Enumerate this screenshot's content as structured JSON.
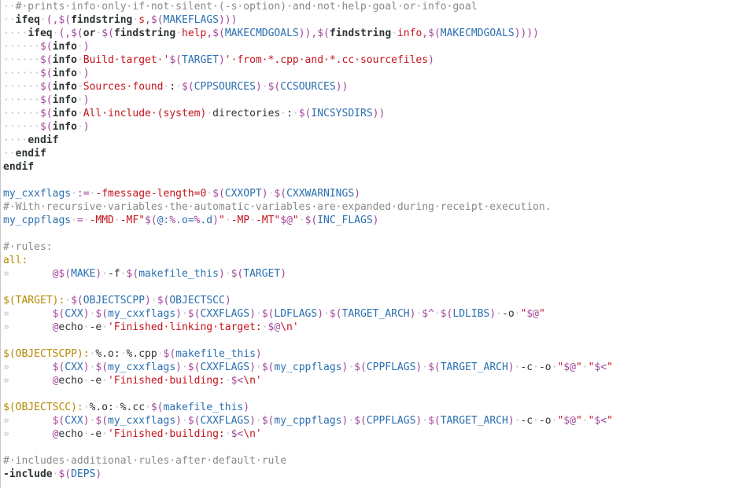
{
  "editor": {
    "language": "Makefile",
    "lines": [
      [
        [
          "ws",
          "··"
        ],
        [
          "cm",
          "#·prints·info·only·if·not·silent·(-s·option)·and·not·help·goal·or·info·goal"
        ]
      ],
      [
        [
          "ws",
          "··"
        ],
        [
          "kw",
          "ifeq"
        ],
        [
          "ws",
          "·"
        ],
        [
          "dl",
          "(,$("
        ],
        [
          "fn",
          "findstring"
        ],
        [
          "ws",
          "·"
        ],
        [
          "str",
          "s"
        ],
        [
          "dl",
          ",$("
        ],
        [
          "var",
          "MAKEFLAGS"
        ],
        [
          "dl",
          ")))"
        ]
      ],
      [
        [
          "ws",
          "····"
        ],
        [
          "kw",
          "ifeq"
        ],
        [
          "ws",
          "·"
        ],
        [
          "dl",
          "(,$("
        ],
        [
          "fn",
          "or"
        ],
        [
          "ws",
          "·"
        ],
        [
          "dl",
          "$("
        ],
        [
          "fn",
          "findstring"
        ],
        [
          "ws",
          "·"
        ],
        [
          "str",
          "help"
        ],
        [
          "dl",
          ",$("
        ],
        [
          "var",
          "MAKECMDGOALS"
        ],
        [
          "dl",
          "))"
        ],
        [
          "dl",
          ",$("
        ],
        [
          "fn",
          "findstring"
        ],
        [
          "ws",
          "·"
        ],
        [
          "str",
          "info"
        ],
        [
          "dl",
          ",$("
        ],
        [
          "var",
          "MAKECMDGOALS"
        ],
        [
          "dl",
          "))))"
        ]
      ],
      [
        [
          "ws",
          "······"
        ],
        [
          "dl",
          "$("
        ],
        [
          "fn",
          "info"
        ],
        [
          "ws",
          "·"
        ],
        [
          "dl",
          ")"
        ]
      ],
      [
        [
          "ws",
          "······"
        ],
        [
          "dl",
          "$("
        ],
        [
          "fn",
          "info"
        ],
        [
          "ws",
          "·"
        ],
        [
          "str",
          "Build·target·'"
        ],
        [
          "dl",
          "$("
        ],
        [
          "var",
          "TARGET"
        ],
        [
          "dl",
          ")"
        ],
        [
          "str",
          "'·from·*.cpp·and·*.cc·sourcefiles"
        ],
        [
          "dl",
          ")"
        ]
      ],
      [
        [
          "ws",
          "······"
        ],
        [
          "dl",
          "$("
        ],
        [
          "fn",
          "info"
        ],
        [
          "ws",
          "·"
        ],
        [
          "dl",
          ")"
        ]
      ],
      [
        [
          "ws",
          "······"
        ],
        [
          "dl",
          "$("
        ],
        [
          "fn",
          "info"
        ],
        [
          "ws",
          "·"
        ],
        [
          "str",
          "Sources·found"
        ],
        [
          "ws",
          "·"
        ],
        [
          "plain",
          ":"
        ],
        [
          "ws",
          "·"
        ],
        [
          "dl",
          "$("
        ],
        [
          "var",
          "CPPSOURCES"
        ],
        [
          "dl",
          ")"
        ],
        [
          "ws",
          "·"
        ],
        [
          "dl",
          "$("
        ],
        [
          "var",
          "CCSOURCES"
        ],
        [
          "dl",
          "))"
        ]
      ],
      [
        [
          "ws",
          "······"
        ],
        [
          "dl",
          "$("
        ],
        [
          "fn",
          "info"
        ],
        [
          "ws",
          "·"
        ],
        [
          "dl",
          ")"
        ]
      ],
      [
        [
          "ws",
          "······"
        ],
        [
          "dl",
          "$("
        ],
        [
          "fn",
          "info"
        ],
        [
          "ws",
          "·"
        ],
        [
          "str",
          "All·include·(system)"
        ],
        [
          "ws",
          "·"
        ],
        [
          "plain",
          "directories"
        ],
        [
          "ws",
          "·"
        ],
        [
          "plain",
          ":"
        ],
        [
          "ws",
          "·"
        ],
        [
          "dl",
          "$("
        ],
        [
          "var",
          "INCSYSDIRS"
        ],
        [
          "dl",
          "))"
        ]
      ],
      [
        [
          "ws",
          "······"
        ],
        [
          "dl",
          "$("
        ],
        [
          "fn",
          "info"
        ],
        [
          "ws",
          "·"
        ],
        [
          "dl",
          ")"
        ]
      ],
      [
        [
          "ws",
          "····"
        ],
        [
          "kw",
          "endif"
        ]
      ],
      [
        [
          "ws",
          "··"
        ],
        [
          "kw",
          "endif"
        ]
      ],
      [
        [
          "kw",
          "endif"
        ]
      ],
      [],
      [
        [
          "lhs",
          "my_cxxflags"
        ],
        [
          "ws",
          "·"
        ],
        [
          "op",
          ":="
        ],
        [
          "ws",
          "·"
        ],
        [
          "str",
          "-fmessage-length=0"
        ],
        [
          "ws",
          "·"
        ],
        [
          "dl",
          "$("
        ],
        [
          "var",
          "CXXOPT"
        ],
        [
          "dl",
          ")"
        ],
        [
          "ws",
          "·"
        ],
        [
          "dl",
          "$("
        ],
        [
          "var",
          "CXXWARNINGS"
        ],
        [
          "dl",
          ")"
        ]
      ],
      [
        [
          "cm",
          "#·With·recursive·variables·the·automatic·variables·are·expanded·during·receipt·execution."
        ]
      ],
      [
        [
          "lhs",
          "my_cppflags"
        ],
        [
          "ws",
          "·"
        ],
        [
          "op",
          "="
        ],
        [
          "ws",
          "·"
        ],
        [
          "str",
          "-MMD"
        ],
        [
          "ws",
          "·"
        ],
        [
          "str",
          "-MF\""
        ],
        [
          "dl",
          "$("
        ],
        [
          "var",
          "@:"
        ],
        [
          "dl",
          "%"
        ],
        [
          "var",
          ".o="
        ],
        [
          "dl",
          "%"
        ],
        [
          "var",
          ".d"
        ],
        [
          "dl",
          ")"
        ],
        [
          "str",
          "\""
        ],
        [
          "ws",
          "·"
        ],
        [
          "str",
          "-MP"
        ],
        [
          "ws",
          "·"
        ],
        [
          "str",
          "-MT\""
        ],
        [
          "dl",
          "$@"
        ],
        [
          "str",
          "\""
        ],
        [
          "ws",
          "·"
        ],
        [
          "dl",
          "$("
        ],
        [
          "var",
          "INC_FLAGS"
        ],
        [
          "dl",
          ")"
        ]
      ],
      [],
      [
        [
          "cm",
          "#·rules:"
        ]
      ],
      [
        [
          "tgt",
          "all:"
        ]
      ],
      [
        [
          "tab",
          "»"
        ],
        [
          "dl",
          "@$("
        ],
        [
          "var",
          "MAKE"
        ],
        [
          "dl",
          ")"
        ],
        [
          "ws",
          "·"
        ],
        [
          "plain",
          "-f"
        ],
        [
          "ws",
          "·"
        ],
        [
          "dl",
          "$("
        ],
        [
          "var",
          "makefile_this"
        ],
        [
          "dl",
          ")"
        ],
        [
          "ws",
          "·"
        ],
        [
          "dl",
          "$("
        ],
        [
          "var",
          "TARGET"
        ],
        [
          "dl",
          ")"
        ]
      ],
      [],
      [
        [
          "tgt",
          "$(TARGET):"
        ],
        [
          "ws",
          "·"
        ],
        [
          "dl",
          "$("
        ],
        [
          "var",
          "OBJECTSCPP"
        ],
        [
          "dl",
          ")"
        ],
        [
          "ws",
          "·"
        ],
        [
          "dl",
          "$("
        ],
        [
          "var",
          "OBJECTSCC"
        ],
        [
          "dl",
          ")"
        ]
      ],
      [
        [
          "tab",
          "»"
        ],
        [
          "dl",
          "$("
        ],
        [
          "var",
          "CXX"
        ],
        [
          "dl",
          ")"
        ],
        [
          "ws",
          "·"
        ],
        [
          "dl",
          "$("
        ],
        [
          "var",
          "my_cxxflags"
        ],
        [
          "dl",
          ")"
        ],
        [
          "ws",
          "·"
        ],
        [
          "dl",
          "$("
        ],
        [
          "var",
          "CXXFLAGS"
        ],
        [
          "dl",
          ")"
        ],
        [
          "ws",
          "·"
        ],
        [
          "dl",
          "$("
        ],
        [
          "var",
          "LDFLAGS"
        ],
        [
          "dl",
          ")"
        ],
        [
          "ws",
          "·"
        ],
        [
          "dl",
          "$("
        ],
        [
          "var",
          "TARGET_ARCH"
        ],
        [
          "dl",
          ")"
        ],
        [
          "ws",
          "·"
        ],
        [
          "dl",
          "$^"
        ],
        [
          "ws",
          "·"
        ],
        [
          "dl",
          "$("
        ],
        [
          "var",
          "LDLIBS"
        ],
        [
          "dl",
          ")"
        ],
        [
          "ws",
          "·"
        ],
        [
          "plain",
          "-o"
        ],
        [
          "ws",
          "·"
        ],
        [
          "str",
          "\""
        ],
        [
          "dl",
          "$@"
        ],
        [
          "str",
          "\""
        ]
      ],
      [
        [
          "tab",
          "»"
        ],
        [
          "dl",
          "@"
        ],
        [
          "plain",
          "echo"
        ],
        [
          "ws",
          "·"
        ],
        [
          "plain",
          "-e"
        ],
        [
          "ws",
          "·"
        ],
        [
          "str",
          "'Finished·linking·target:"
        ],
        [
          "ws",
          "·"
        ],
        [
          "dl",
          "$@"
        ],
        [
          "str",
          "\\n'"
        ]
      ],
      [],
      [
        [
          "tgt",
          "$(OBJECTSCPP):"
        ],
        [
          "ws",
          "·"
        ],
        [
          "plain",
          "%.o:"
        ],
        [
          "ws",
          "·"
        ],
        [
          "plain",
          "%.cpp"
        ],
        [
          "ws",
          "·"
        ],
        [
          "dl",
          "$("
        ],
        [
          "var",
          "makefile_this"
        ],
        [
          "dl",
          ")"
        ]
      ],
      [
        [
          "tab",
          "»"
        ],
        [
          "dl",
          "$("
        ],
        [
          "var",
          "CXX"
        ],
        [
          "dl",
          ")"
        ],
        [
          "ws",
          "·"
        ],
        [
          "dl",
          "$("
        ],
        [
          "var",
          "my_cxxflags"
        ],
        [
          "dl",
          ")"
        ],
        [
          "ws",
          "·"
        ],
        [
          "dl",
          "$("
        ],
        [
          "var",
          "CXXFLAGS"
        ],
        [
          "dl",
          ")"
        ],
        [
          "ws",
          "·"
        ],
        [
          "dl",
          "$("
        ],
        [
          "var",
          "my_cppflags"
        ],
        [
          "dl",
          ")"
        ],
        [
          "ws",
          "·"
        ],
        [
          "dl",
          "$("
        ],
        [
          "var",
          "CPPFLAGS"
        ],
        [
          "dl",
          ")"
        ],
        [
          "ws",
          "·"
        ],
        [
          "dl",
          "$("
        ],
        [
          "var",
          "TARGET_ARCH"
        ],
        [
          "dl",
          ")"
        ],
        [
          "ws",
          "·"
        ],
        [
          "plain",
          "-c"
        ],
        [
          "ws",
          "·"
        ],
        [
          "plain",
          "-o"
        ],
        [
          "ws",
          "·"
        ],
        [
          "str",
          "\""
        ],
        [
          "dl",
          "$@"
        ],
        [
          "str",
          "\""
        ],
        [
          "ws",
          "·"
        ],
        [
          "str",
          "\""
        ],
        [
          "dl",
          "$<"
        ],
        [
          "str",
          "\""
        ]
      ],
      [
        [
          "tab",
          "»"
        ],
        [
          "dl",
          "@"
        ],
        [
          "plain",
          "echo"
        ],
        [
          "ws",
          "·"
        ],
        [
          "plain",
          "-e"
        ],
        [
          "ws",
          "·"
        ],
        [
          "str",
          "'Finished·building:"
        ],
        [
          "ws",
          "·"
        ],
        [
          "dl",
          "$<"
        ],
        [
          "str",
          "\\n'"
        ]
      ],
      [],
      [
        [
          "tgt",
          "$(OBJECTSCC):"
        ],
        [
          "ws",
          "·"
        ],
        [
          "plain",
          "%.o:"
        ],
        [
          "ws",
          "·"
        ],
        [
          "plain",
          "%.cc"
        ],
        [
          "ws",
          "·"
        ],
        [
          "dl",
          "$("
        ],
        [
          "var",
          "makefile_this"
        ],
        [
          "dl",
          ")"
        ]
      ],
      [
        [
          "tab",
          "»"
        ],
        [
          "dl",
          "$("
        ],
        [
          "var",
          "CXX"
        ],
        [
          "dl",
          ")"
        ],
        [
          "ws",
          "·"
        ],
        [
          "dl",
          "$("
        ],
        [
          "var",
          "my_cxxflags"
        ],
        [
          "dl",
          ")"
        ],
        [
          "ws",
          "·"
        ],
        [
          "dl",
          "$("
        ],
        [
          "var",
          "CXXFLAGS"
        ],
        [
          "dl",
          ")"
        ],
        [
          "ws",
          "·"
        ],
        [
          "dl",
          "$("
        ],
        [
          "var",
          "my_cppflags"
        ],
        [
          "dl",
          ")"
        ],
        [
          "ws",
          "·"
        ],
        [
          "dl",
          "$("
        ],
        [
          "var",
          "CPPFLAGS"
        ],
        [
          "dl",
          ")"
        ],
        [
          "ws",
          "·"
        ],
        [
          "dl",
          "$("
        ],
        [
          "var",
          "TARGET_ARCH"
        ],
        [
          "dl",
          ")"
        ],
        [
          "ws",
          "·"
        ],
        [
          "plain",
          "-c"
        ],
        [
          "ws",
          "·"
        ],
        [
          "plain",
          "-o"
        ],
        [
          "ws",
          "·"
        ],
        [
          "str",
          "\""
        ],
        [
          "dl",
          "$@"
        ],
        [
          "str",
          "\""
        ],
        [
          "ws",
          "·"
        ],
        [
          "str",
          "\""
        ],
        [
          "dl",
          "$<"
        ],
        [
          "str",
          "\""
        ]
      ],
      [
        [
          "tab",
          "»"
        ],
        [
          "dl",
          "@"
        ],
        [
          "plain",
          "echo"
        ],
        [
          "ws",
          "·"
        ],
        [
          "plain",
          "-e"
        ],
        [
          "ws",
          "·"
        ],
        [
          "str",
          "'Finished·building:"
        ],
        [
          "ws",
          "·"
        ],
        [
          "dl",
          "$<"
        ],
        [
          "str",
          "\\n'"
        ]
      ],
      [],
      [
        [
          "cm",
          "#·includes·additional·rules·after·default·rule"
        ]
      ],
      [
        [
          "kw",
          "-include"
        ],
        [
          "ws",
          "·"
        ],
        [
          "dl",
          "$("
        ],
        [
          "var",
          "DEPS"
        ],
        [
          "dl",
          ")"
        ]
      ]
    ]
  },
  "colors": {
    "comment": "#8a8a8a",
    "keyword": "#2e3436",
    "dollar_paren": "#a3469b",
    "variable": "#2a6fb0",
    "string": "#c4141c",
    "target": "#b58900",
    "whitespace_marker": "#c0c0c0"
  }
}
